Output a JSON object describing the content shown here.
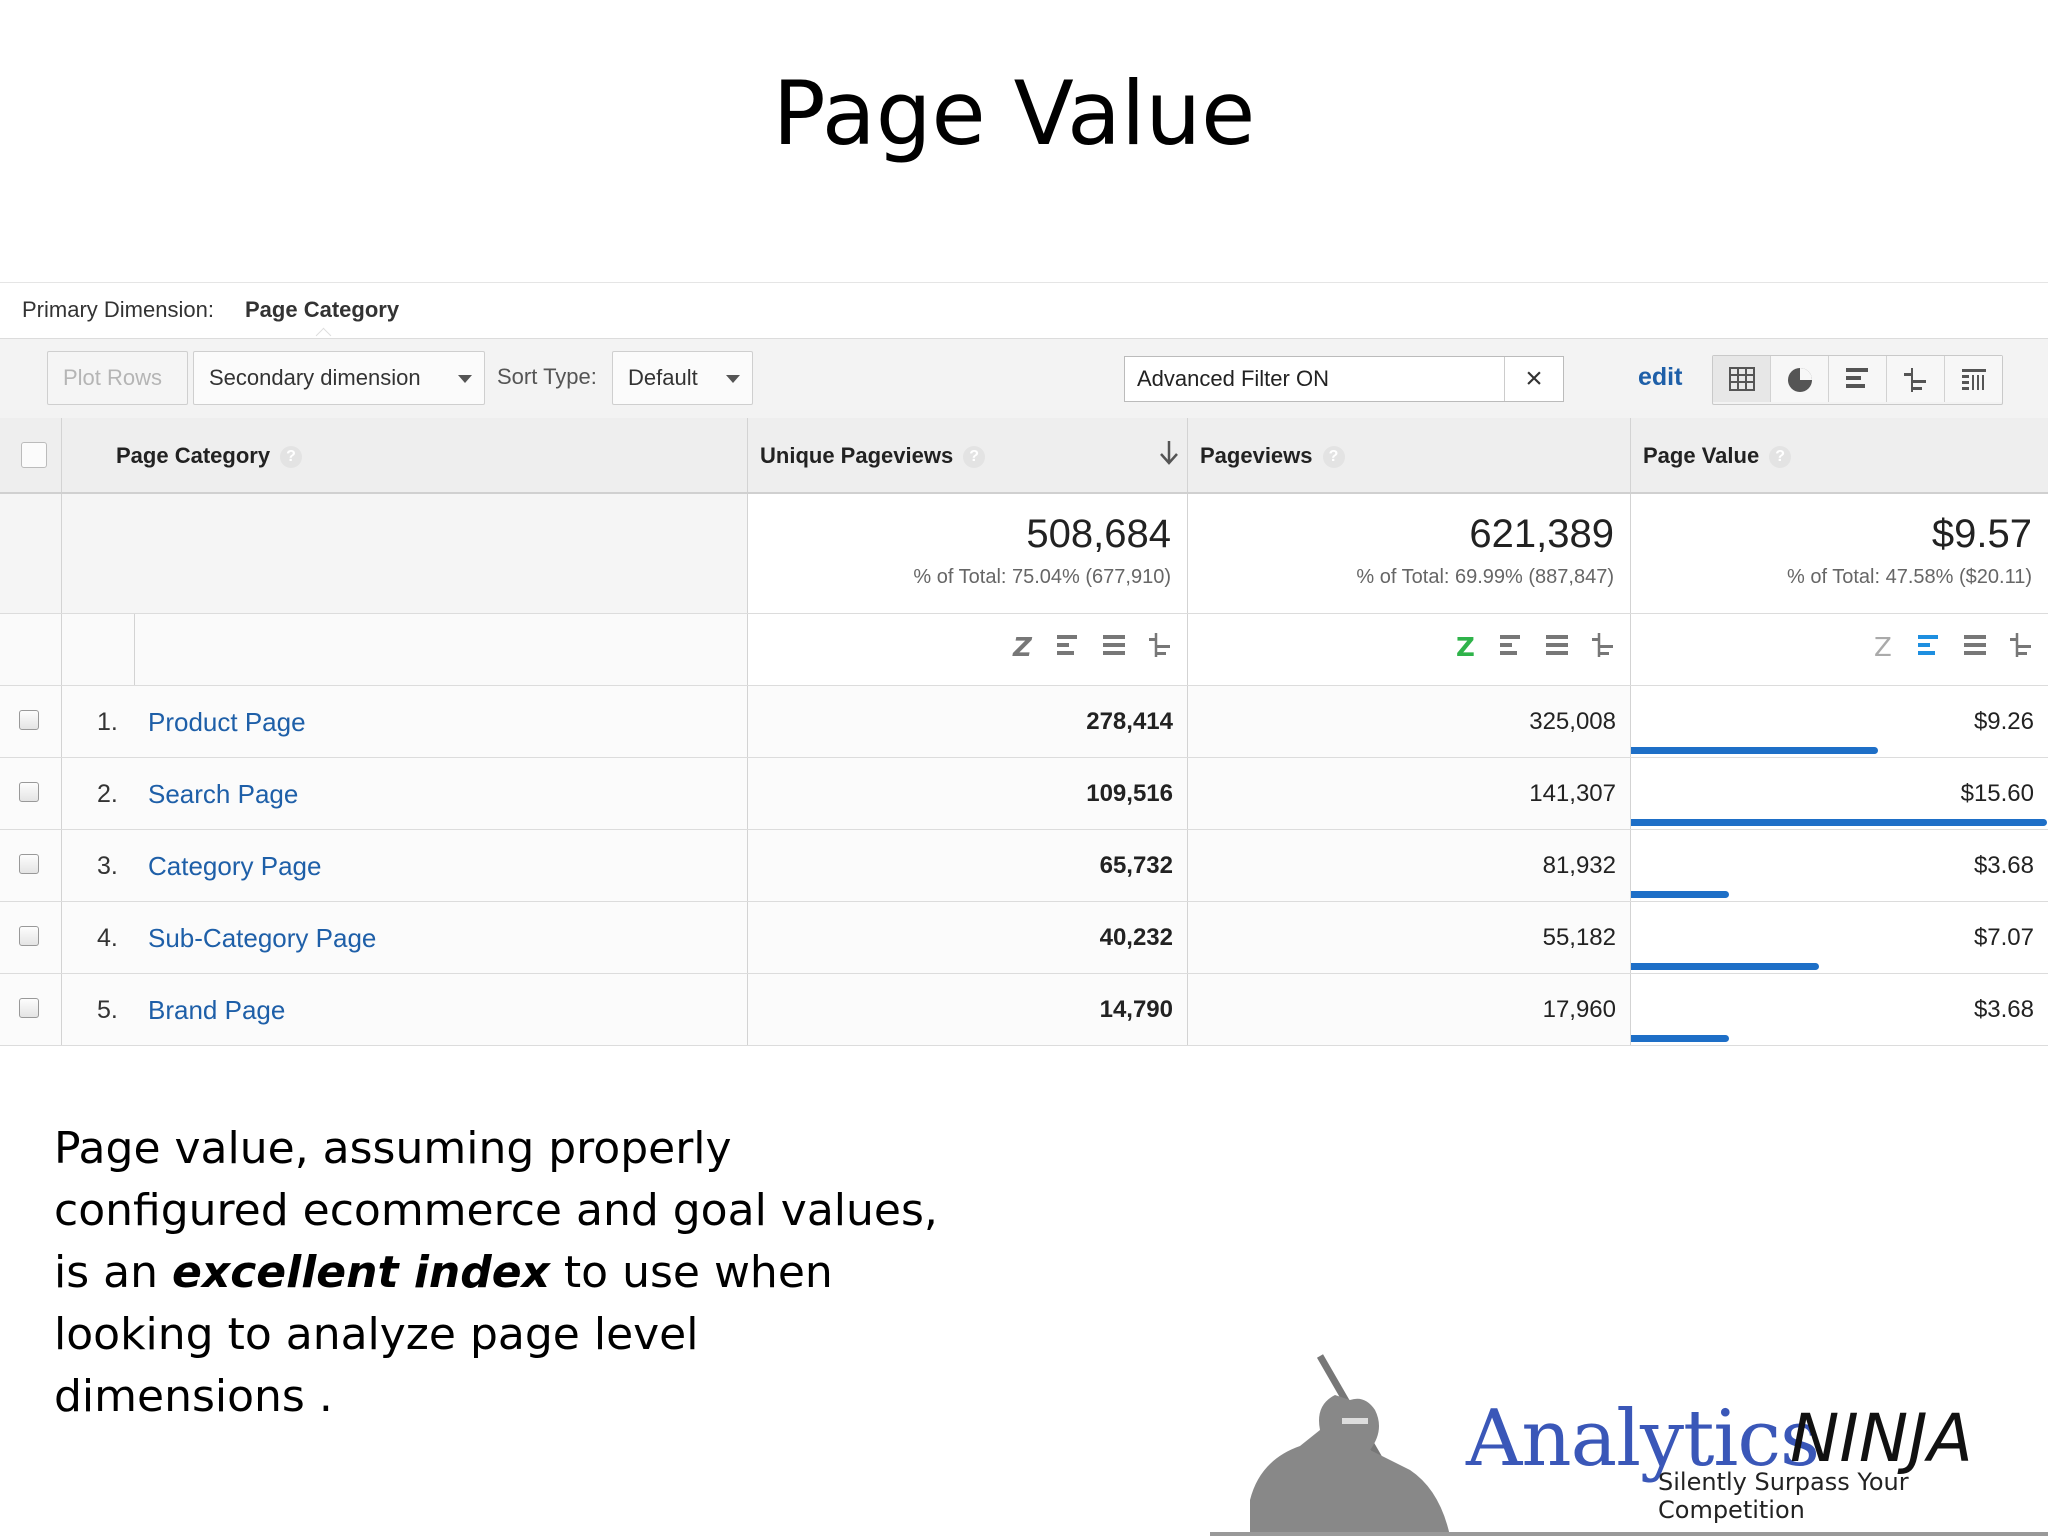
{
  "slide": {
    "title": "Page Value",
    "caption_part1": "Page value, assuming properly configured ecommerce and goal values, is an ",
    "caption_emph": "excellent index",
    "caption_part2": " to use when looking to analyze page level dimensions ."
  },
  "report": {
    "primary_dimension_label": "Primary Dimension:",
    "primary_dimension_value": "Page Category",
    "toolbar": {
      "plot_rows": "Plot Rows",
      "secondary_dimension": "Secondary dimension",
      "sort_type_label": "Sort Type:",
      "sort_type_value": "Default",
      "filter_text": "Advanced Filter ON",
      "filter_clear": "×",
      "edit": "edit",
      "view_icons": [
        "table-view-icon",
        "pie-view-icon",
        "performance-view-icon",
        "comparison-view-icon",
        "pivot-view-icon"
      ]
    },
    "columns": {
      "dimension": "Page Category",
      "unique_pageviews": "Unique Pageviews",
      "pageviews": "Pageviews",
      "page_value": "Page Value",
      "help": "?"
    },
    "totals": {
      "unique_pageviews": {
        "value": "508,684",
        "pct": "% of Total: 75.04% (677,910)"
      },
      "pageviews": {
        "value": "621,389",
        "pct": "% of Total: 69.99% (887,847)"
      },
      "page_value": {
        "value": "$9.57",
        "pct": "% of Total: 47.58% ($20.11)"
      }
    },
    "rows": [
      {
        "num": "1.",
        "category": "Product Page",
        "unique_pageviews": "278,414",
        "pageviews": "325,008",
        "page_value": "$9.26",
        "bar_fraction": 0.594
      },
      {
        "num": "2.",
        "category": "Search Page",
        "unique_pageviews": "109,516",
        "pageviews": "141,307",
        "page_value": "$15.60",
        "bar_fraction": 1.0
      },
      {
        "num": "3.",
        "category": "Category Page",
        "unique_pageviews": "65,732",
        "pageviews": "81,932",
        "page_value": "$3.68",
        "bar_fraction": 0.236
      },
      {
        "num": "4.",
        "category": "Sub-Category Page",
        "unique_pageviews": "40,232",
        "pageviews": "55,182",
        "page_value": "$7.07",
        "bar_fraction": 0.453
      },
      {
        "num": "5.",
        "category": "Brand Page",
        "unique_pageviews": "14,790",
        "pageviews": "17,960",
        "page_value": "$3.68",
        "bar_fraction": 0.236
      }
    ]
  },
  "logo": {
    "word": "Analytics",
    "ninja": "NINJA",
    "tagline": "Silently Surpass Your Competition"
  },
  "colors": {
    "link": "#1e5fa8",
    "bar": "#1e6fc7",
    "z_green": "#2fb34a"
  }
}
